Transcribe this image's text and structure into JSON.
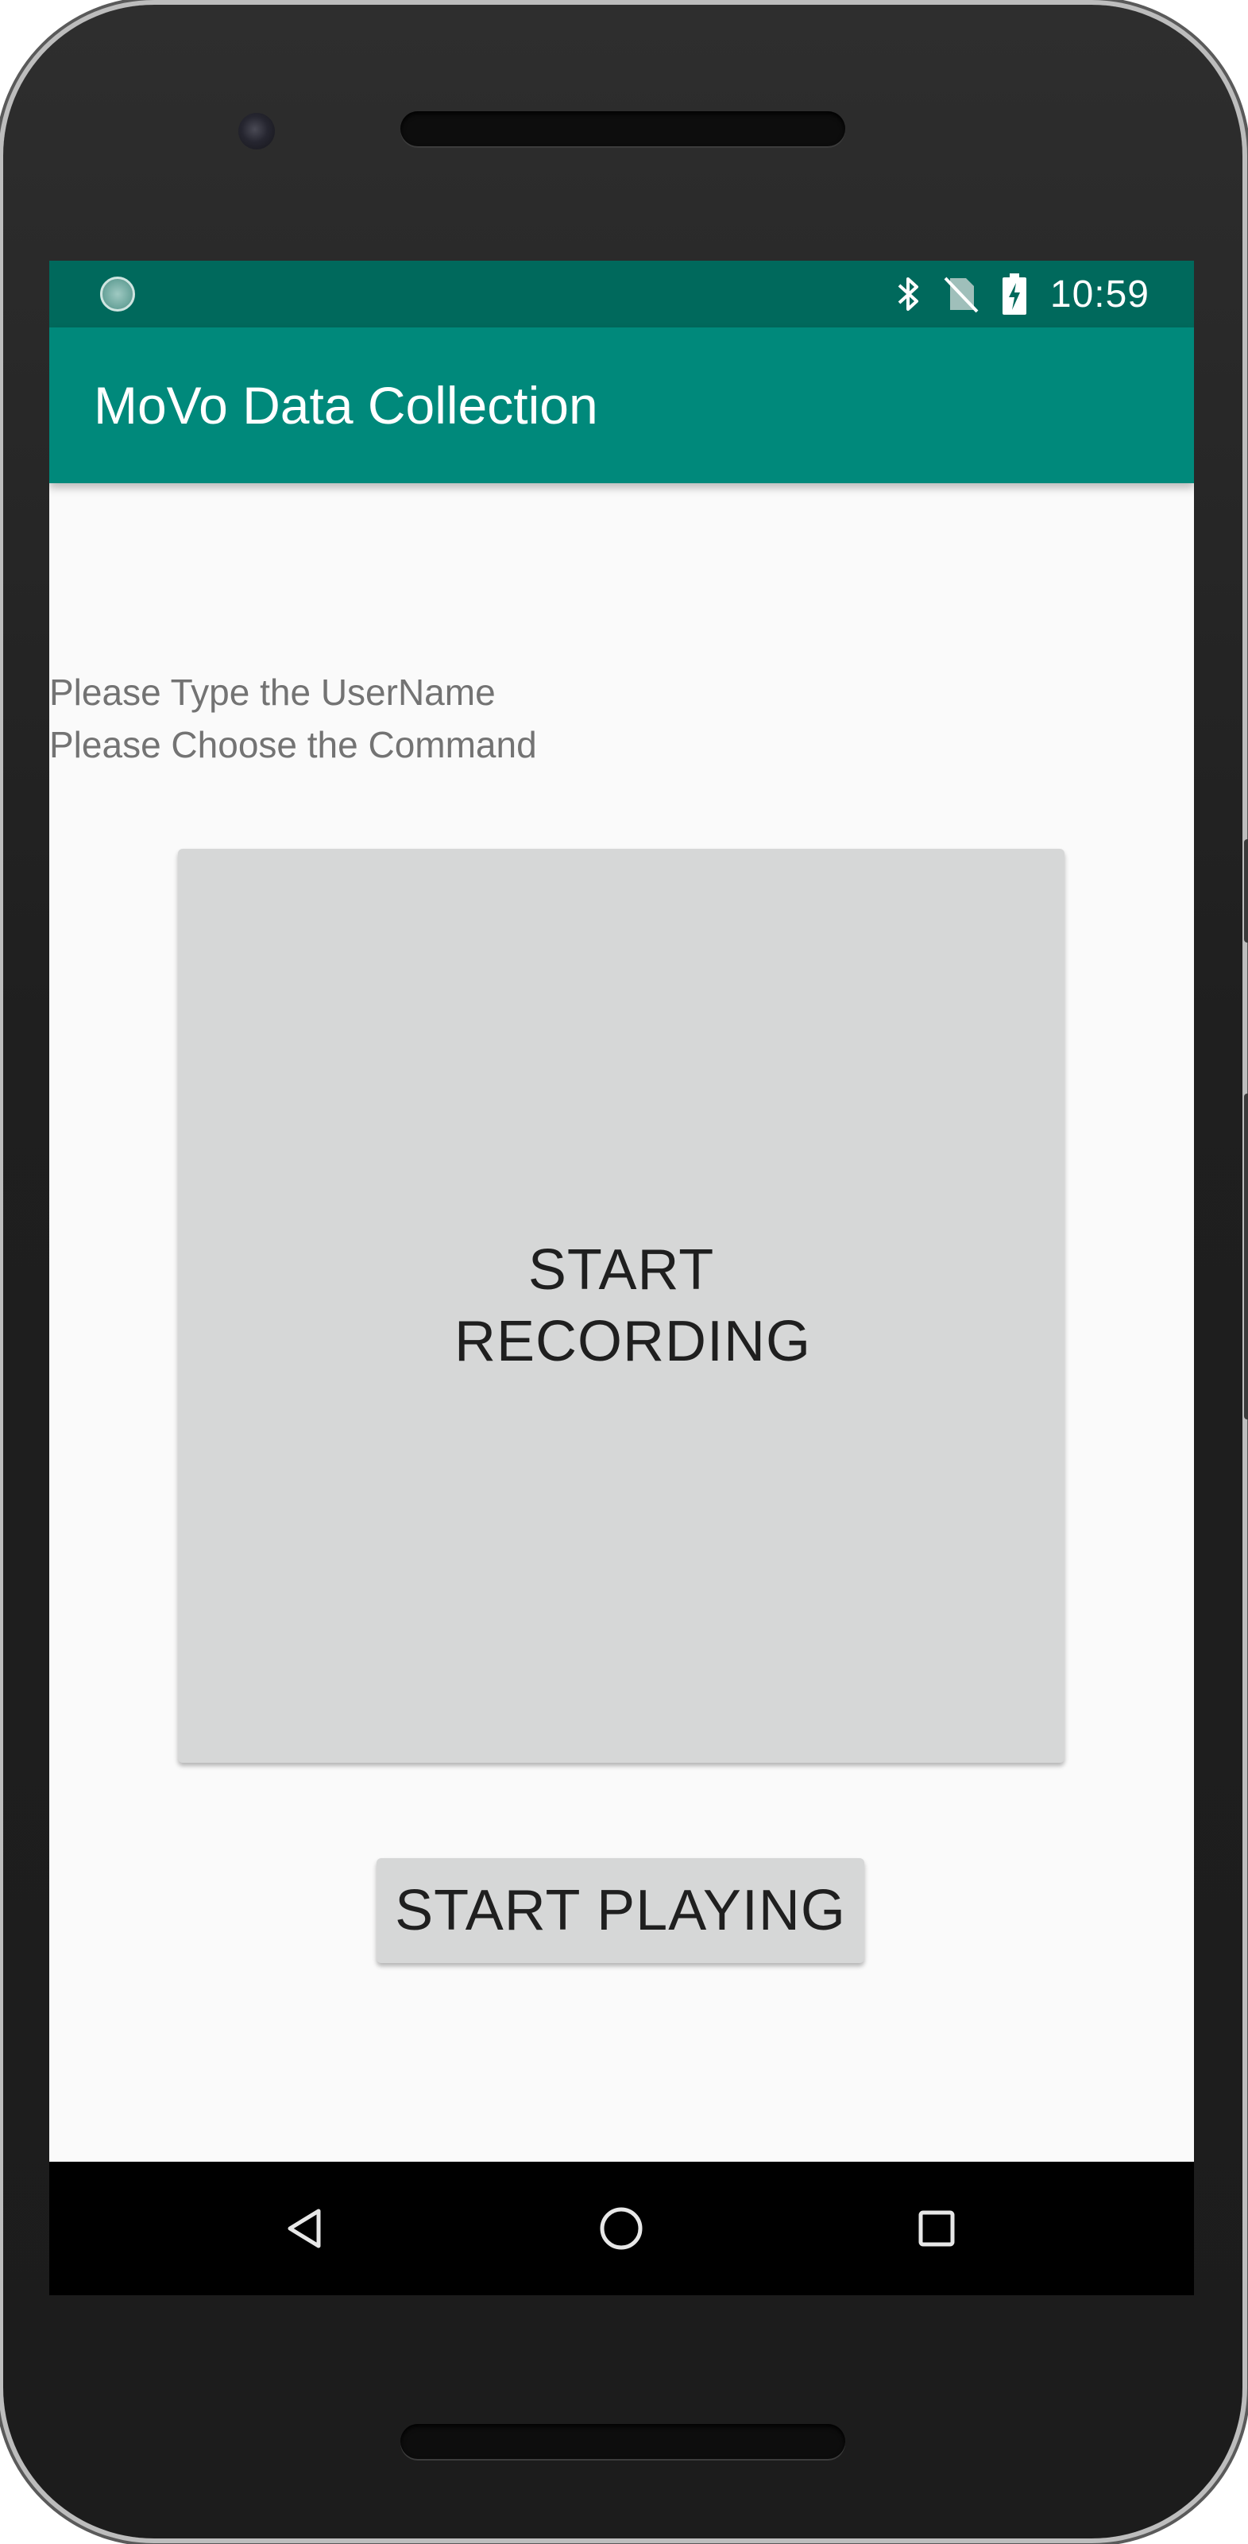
{
  "status_bar": {
    "time": "10:59",
    "icons": [
      "sync-indicator-icon",
      "bluetooth-icon",
      "no-sim-icon",
      "battery-charging-icon"
    ]
  },
  "app_bar": {
    "title": "MoVo Data Collection"
  },
  "main": {
    "username_prompt": "Please Type the UserName",
    "command_prompt": "Please Choose the Command",
    "record_button_label": "START RECORDING",
    "play_button_label": "START PLAYING"
  },
  "nav_bar": {
    "items": [
      "back-icon",
      "home-icon",
      "recents-icon"
    ]
  },
  "colors": {
    "status_bar": "#00695c",
    "app_bar": "#00897b",
    "background": "#fafafa",
    "button": "#d6d7d7"
  }
}
